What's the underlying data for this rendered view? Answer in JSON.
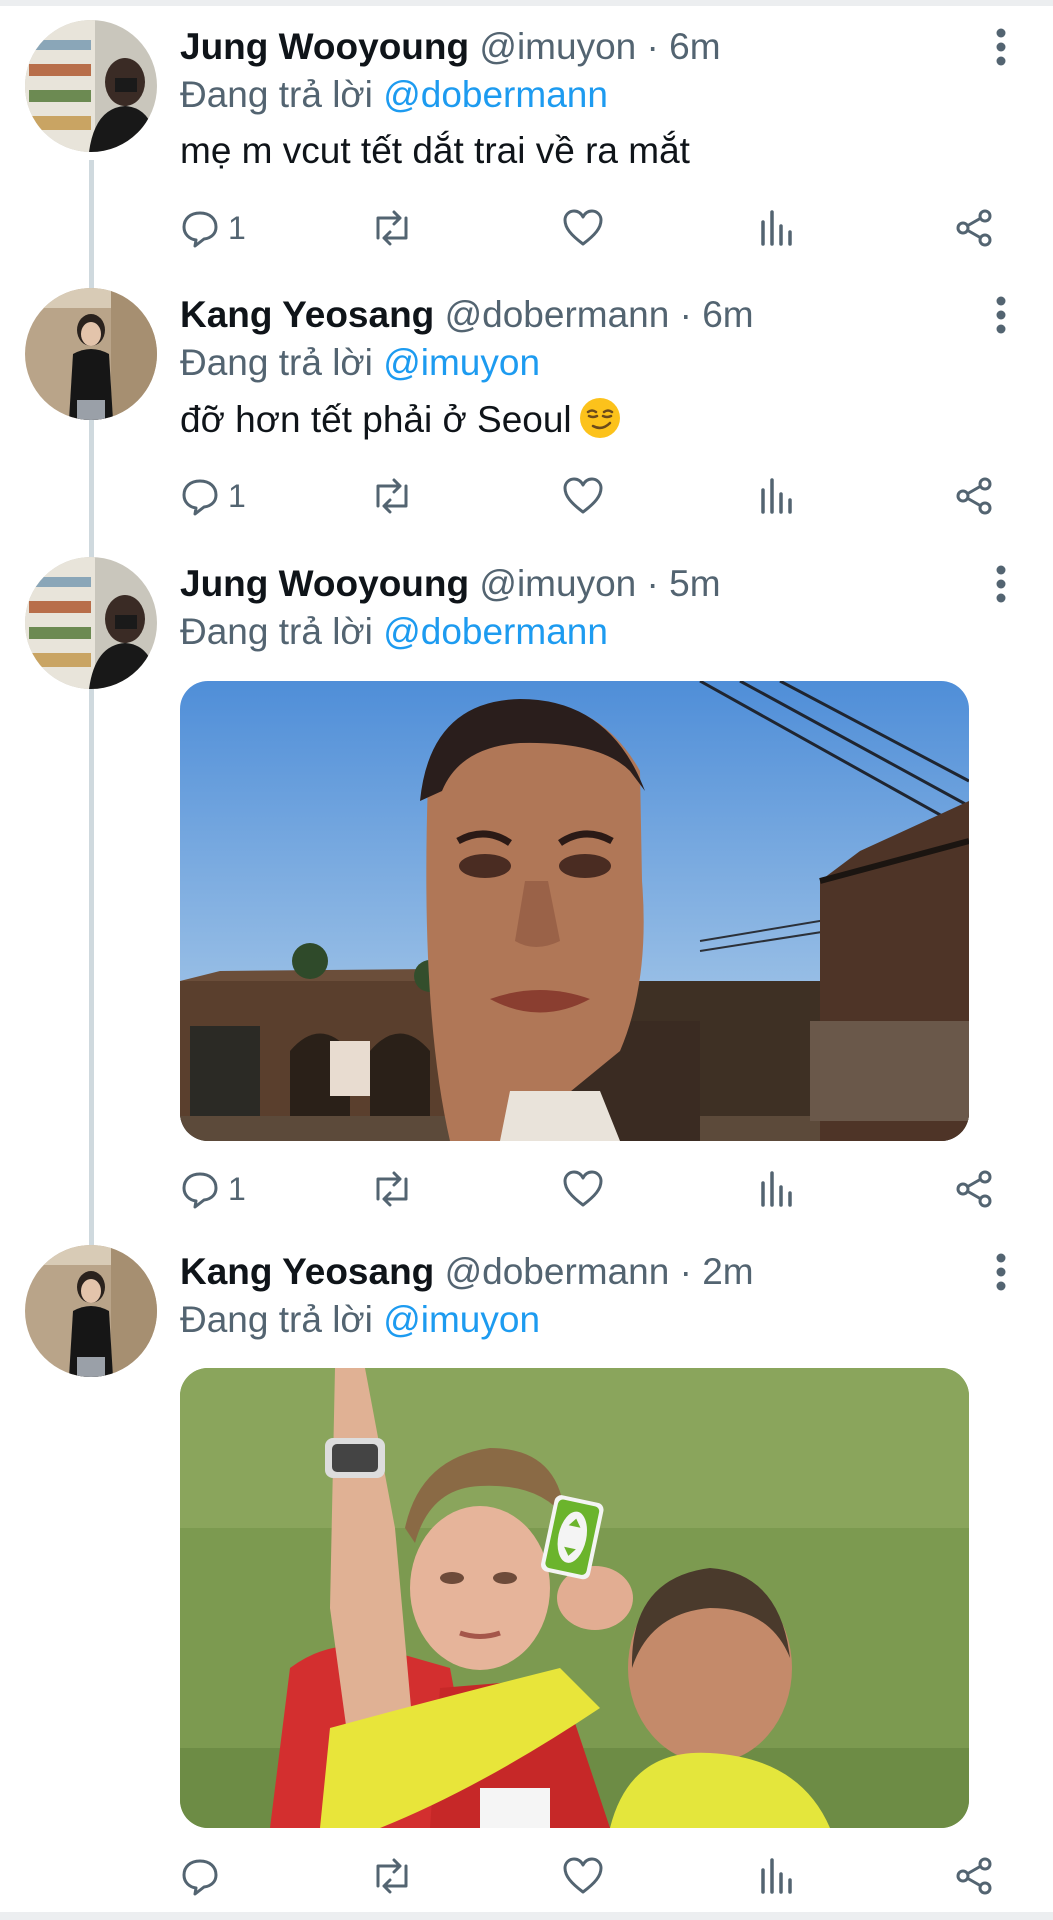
{
  "thread": [
    {
      "name": "Jung Wooyoung",
      "handle": "@imuyon",
      "separator": "·",
      "time": "6m",
      "reply_prefix": "Đang trả lời",
      "reply_to": "@dobermann",
      "text": "mẹ m vcut tết dắt trai về ra mắt",
      "reply_count": "1"
    },
    {
      "name": "Kang Yeosang",
      "handle": "@dobermann",
      "separator": "·",
      "time": "6m",
      "reply_prefix": "Đang trả lời",
      "reply_to": "@imuyon",
      "text": "đỡ hơn tết phải ở Seoul",
      "emoji": "smirking-face",
      "reply_count": "1"
    },
    {
      "name": "Jung Wooyoung",
      "handle": "@imuyon",
      "separator": "·",
      "time": "5m",
      "reply_prefix": "Đang trả lời",
      "reply_to": "@dobermann",
      "media": "mr-bean-game-face-image",
      "reply_count": "1"
    },
    {
      "name": "Kang Yeosang",
      "handle": "@dobermann",
      "separator": "·",
      "time": "2m",
      "reply_prefix": "Đang trả lời",
      "reply_to": "@imuyon",
      "media": "referee-uno-reverse-card-image",
      "reply_count": ""
    }
  ],
  "colors": {
    "link": "#1d9bf0",
    "secondary": "#536471",
    "thread_line": "#cfd9de"
  }
}
